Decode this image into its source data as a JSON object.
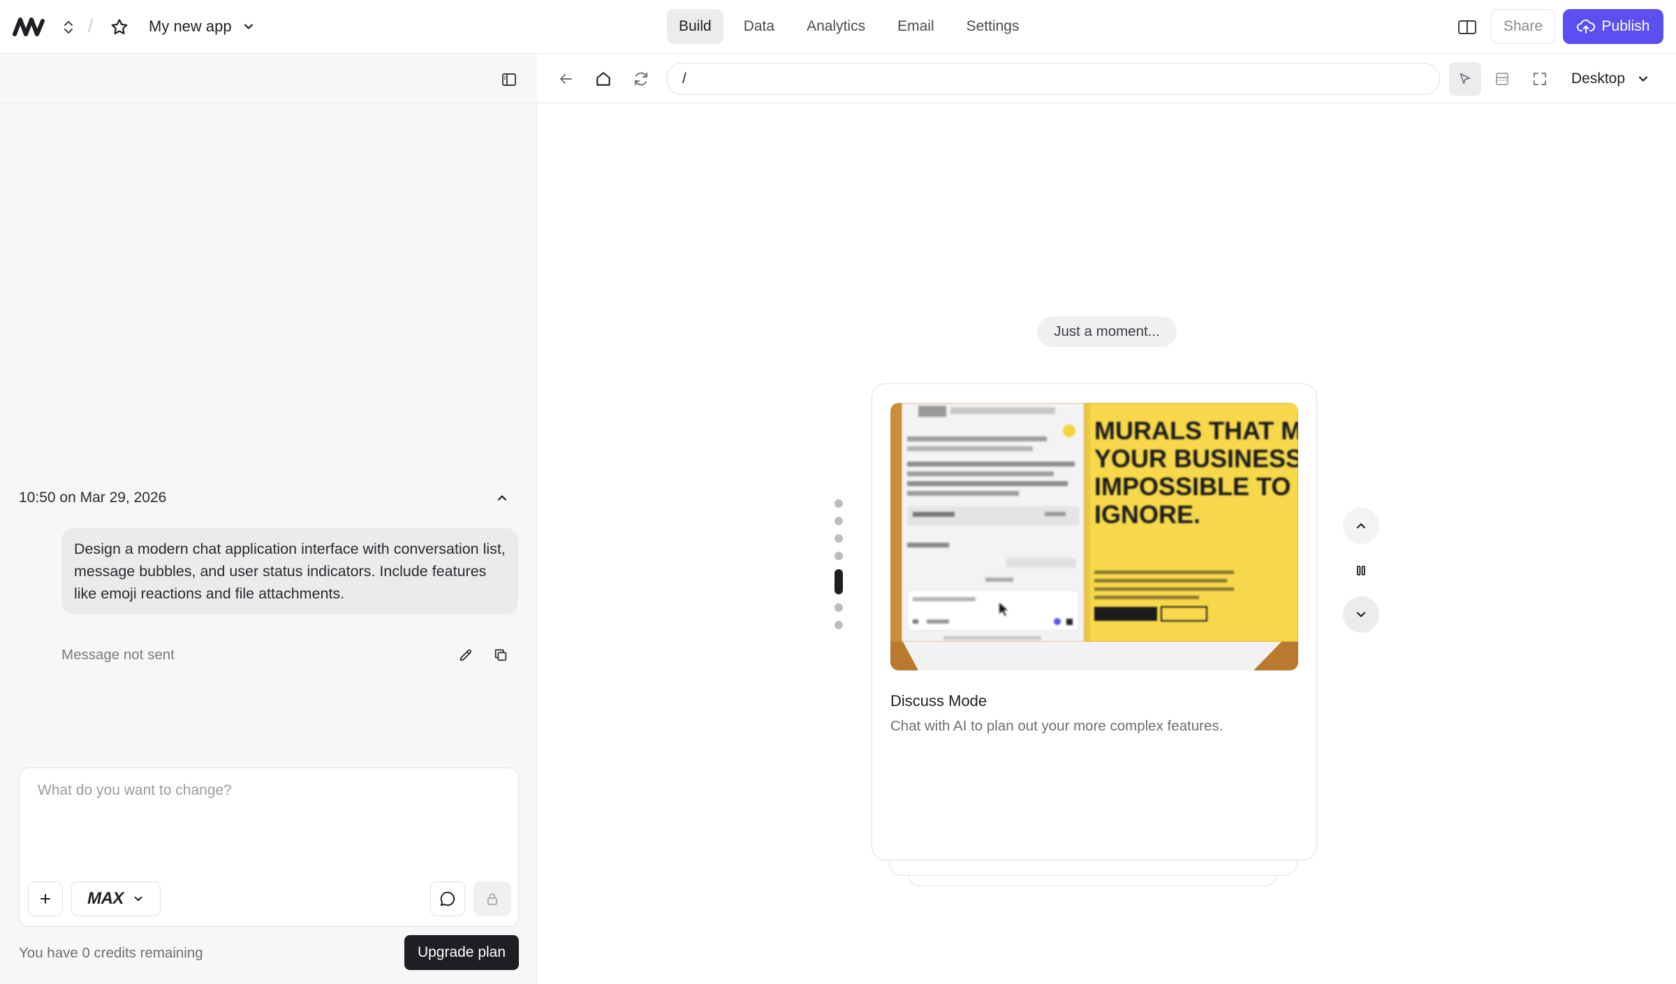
{
  "header": {
    "app_name": "My new app",
    "nav_tabs": [
      {
        "label": "Build",
        "active": true
      },
      {
        "label": "Data",
        "active": false
      },
      {
        "label": "Analytics",
        "active": false
      },
      {
        "label": "Email",
        "active": false
      },
      {
        "label": "Settings",
        "active": false
      }
    ],
    "share_label": "Share",
    "publish_label": "Publish",
    "accent_color": "#5b4ff2"
  },
  "chat": {
    "timestamp": "10:50 on Mar 29, 2026",
    "message": "Design a modern chat application interface with conversation list, message bubbles, and user status indicators. Include features like emoji reactions and file attachments.",
    "status": "Message not sent",
    "composer_placeholder": "What do you want to change?",
    "model": "MAX",
    "credits_text": "You have 0 credits remaining",
    "upgrade_label": "Upgrade plan"
  },
  "preview": {
    "url": "/",
    "device": "Desktop",
    "loading_text": "Just a moment...",
    "feature_card": {
      "title": "Discuss Mode",
      "description": "Chat with AI to plan out your more complex features.",
      "image_headline": "MURALS THAT MAKE YOUR BUSINESS IMPOSSIBLE TO IGNORE."
    },
    "carousel": {
      "total": 7,
      "active_index": 4
    }
  },
  "icons": [
    "logo-icon",
    "switch-project-icon",
    "star-icon",
    "chevron-down-icon",
    "book-icon",
    "cloud-upload-icon",
    "panel-toggle-icon",
    "chevron-up-icon",
    "edit-icon",
    "copy-icon",
    "plus-icon",
    "chat-bubble-icon",
    "lock-icon",
    "back-arrow-icon",
    "home-icon",
    "refresh-icon",
    "cursor-select-icon",
    "layout-icon",
    "fullscreen-icon",
    "pause-icon"
  ]
}
